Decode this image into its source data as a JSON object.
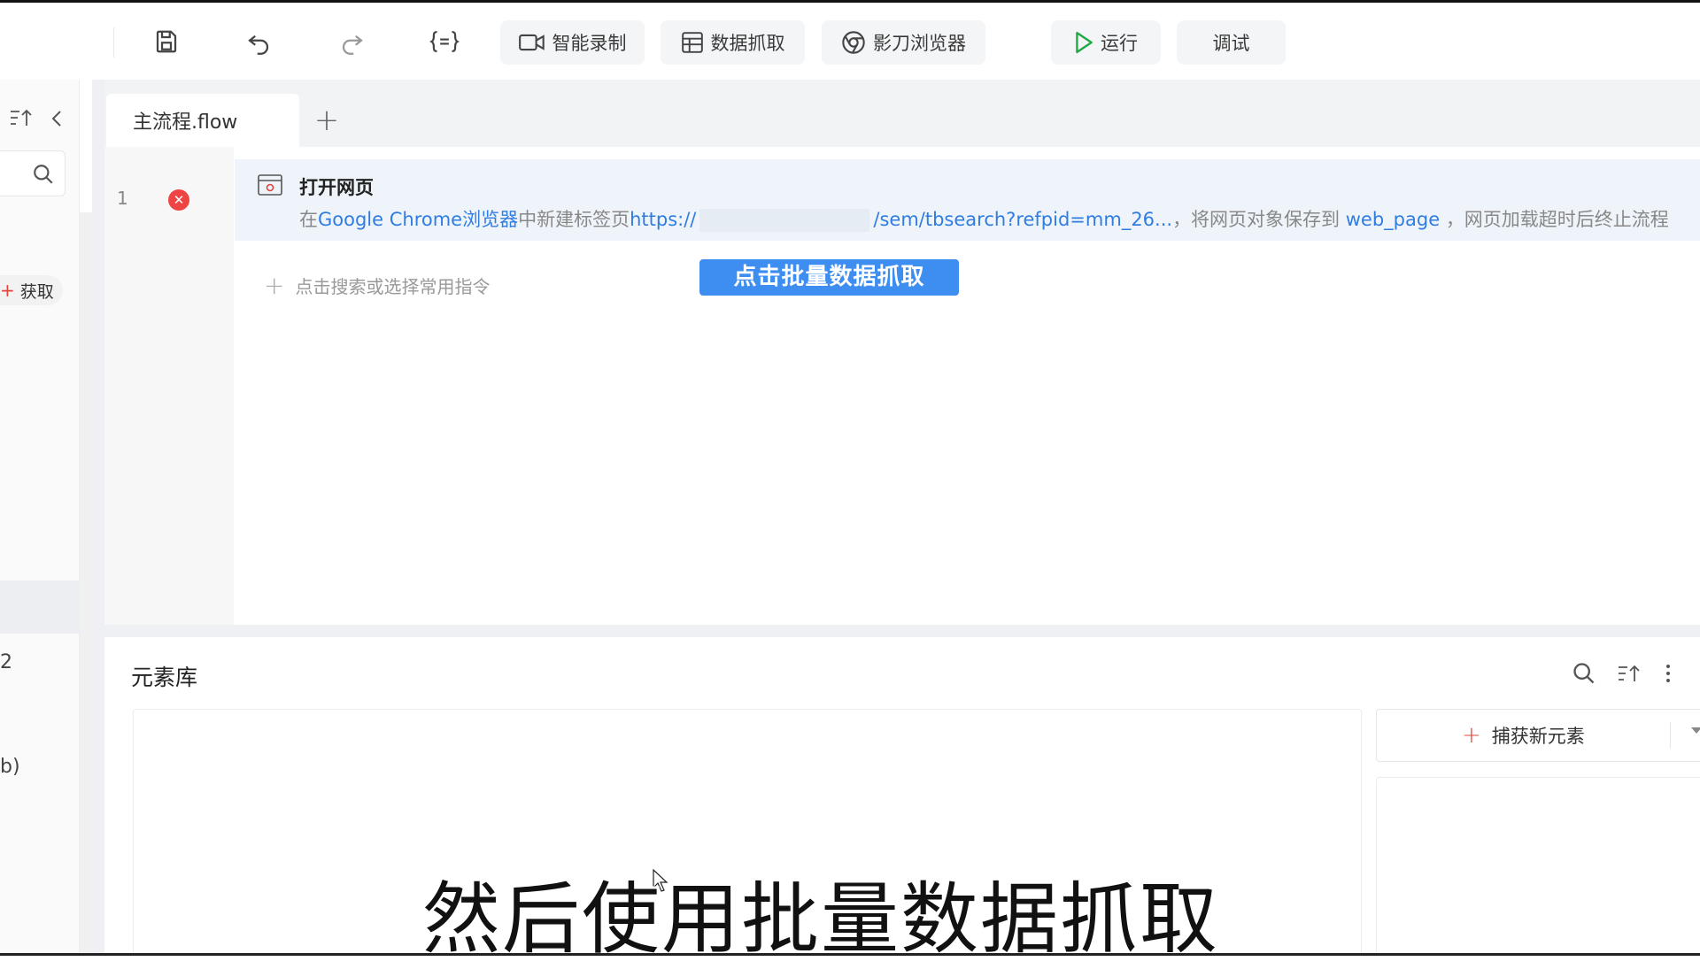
{
  "toolbar": {
    "smart_record": "智能录制",
    "data_scrape": "数据抓取",
    "browser": "影刀浏览器",
    "run": "运行",
    "debug": "调试"
  },
  "left_panel": {
    "fetch_label": "获取",
    "fragment_1": "2",
    "fragment_2": "b)"
  },
  "tabs": {
    "active": "主流程.flow",
    "add": "+"
  },
  "flow": {
    "steps": [
      {
        "number": "1",
        "title": "打开网页",
        "desc_prefix_1": "在",
        "desc_browser": "Google Chrome浏览器",
        "desc_mid_1": "中新建标签页",
        "desc_url_start": "https://",
        "desc_url_end": "/sem/tbsearch?refpid=mm_26...",
        "desc_mid_2": "，将网页对象保存到",
        "desc_var": "web_page",
        "desc_suffix": "，网页加载超时后终止流程"
      }
    ],
    "add_command": "点击搜索或选择常用指令"
  },
  "tooltip": "点击批量数据抓取",
  "element_library": {
    "title": "元素库",
    "capture_button": "捕获新元素"
  },
  "subtitle": "然后使用批量数据抓取",
  "colors": {
    "accent_blue": "#2f7de1",
    "tooltip_bg": "#3d8ef0",
    "error_red": "#ef4444",
    "run_green": "#22a845"
  }
}
